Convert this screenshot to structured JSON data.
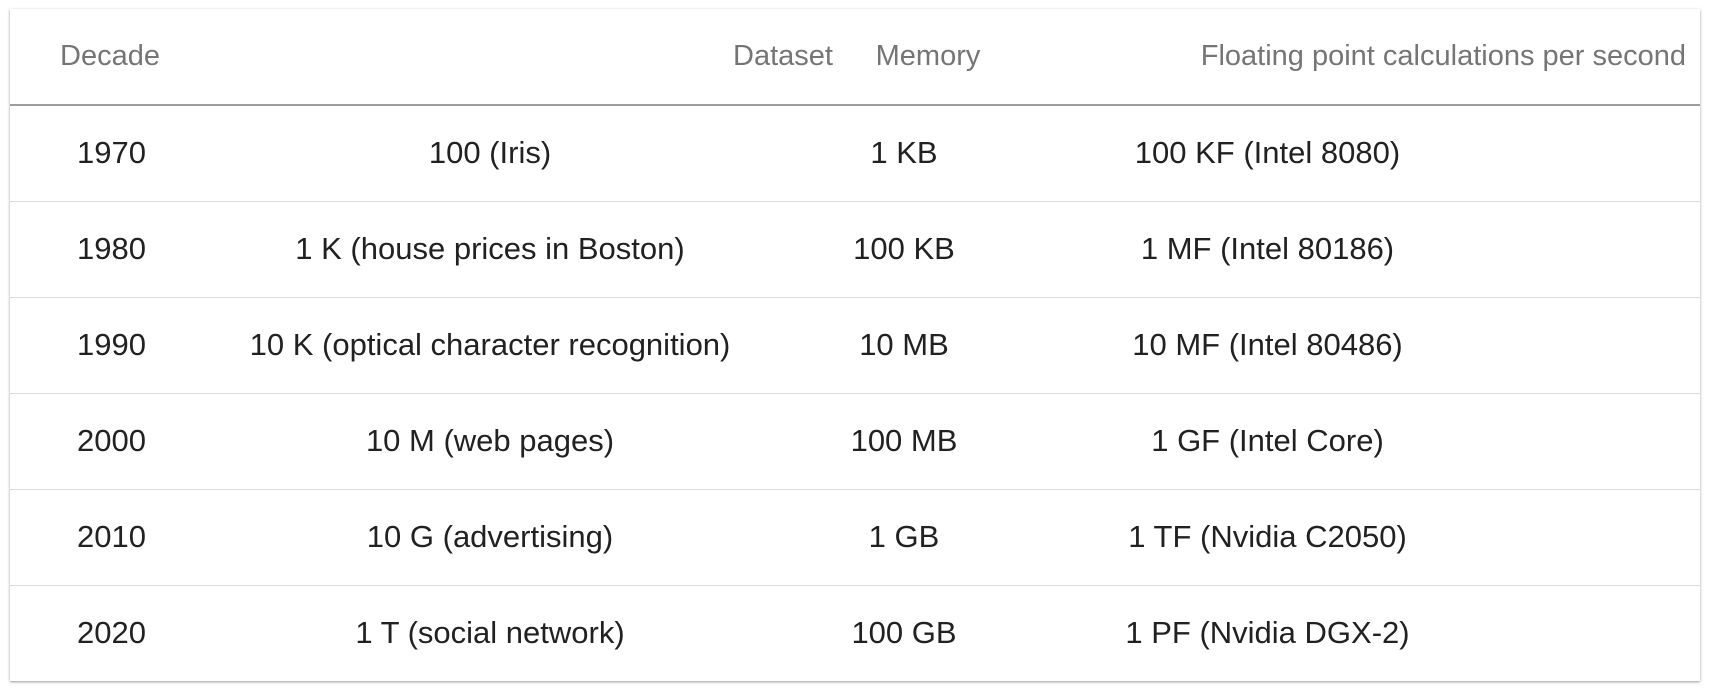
{
  "table": {
    "headers": {
      "decade": "Decade",
      "dataset": "Dataset",
      "memory": "Memory",
      "flops": "Floating point calculations per second"
    },
    "rows": [
      {
        "decade": "1970",
        "dataset": "100 (Iris)",
        "memory": "1 KB",
        "flops": "100 KF (Intel 8080)"
      },
      {
        "decade": "1980",
        "dataset": "1 K (house prices in Boston)",
        "memory": "100 KB",
        "flops": "1 MF (Intel 80186)"
      },
      {
        "decade": "1990",
        "dataset": "10 K (optical character recognition)",
        "memory": "10 MB",
        "flops": "10 MF (Intel 80486)"
      },
      {
        "decade": "2000",
        "dataset": "10 M (web pages)",
        "memory": "100 MB",
        "flops": "1 GF (Intel Core)"
      },
      {
        "decade": "2010",
        "dataset": "10 G (advertising)",
        "memory": "1 GB",
        "flops": "1 TF (Nvidia C2050)"
      },
      {
        "decade": "2020",
        "dataset": "1 T (social network)",
        "memory": "100 GB",
        "flops": "1 PF (Nvidia DGX-2)"
      }
    ]
  }
}
